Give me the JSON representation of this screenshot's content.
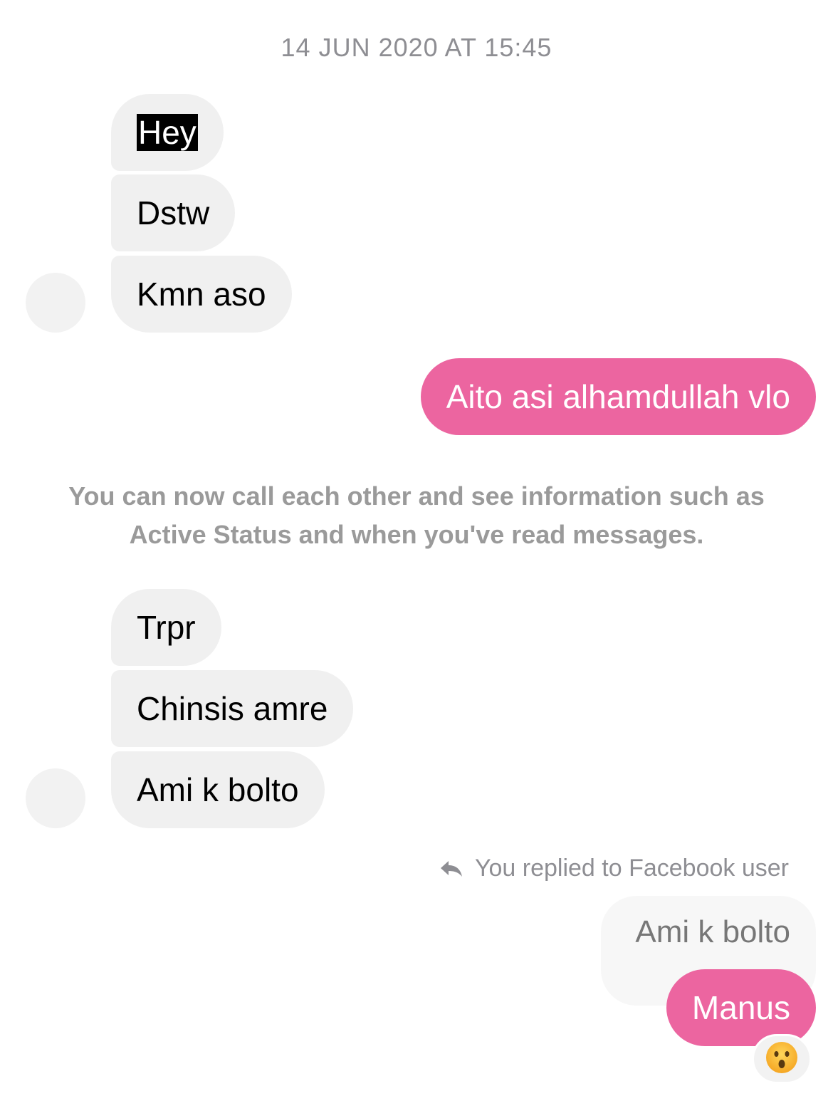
{
  "thread": {
    "timestamp": "14 JUN 2020 AT 15:45",
    "group1": [
      "Hey",
      "Dstw",
      "Kmn aso"
    ],
    "outgoing1": "Aito asi alhamdullah vlo",
    "system_note": "You can now call each other and see information such as Active Status and when you've read messages.",
    "group2": [
      "Trpr",
      "Chinsis amre",
      "Ami k bolto"
    ],
    "reply_label": "You replied to Facebook user",
    "quoted_text": "Ami k bolto",
    "outgoing2": "Manus",
    "reaction_icon": "astonished-face-emoji"
  },
  "colors": {
    "outgoing_bubble": "#ec65a0",
    "incoming_bubble": "#f0f0f0",
    "meta_text": "#8e8e93"
  }
}
